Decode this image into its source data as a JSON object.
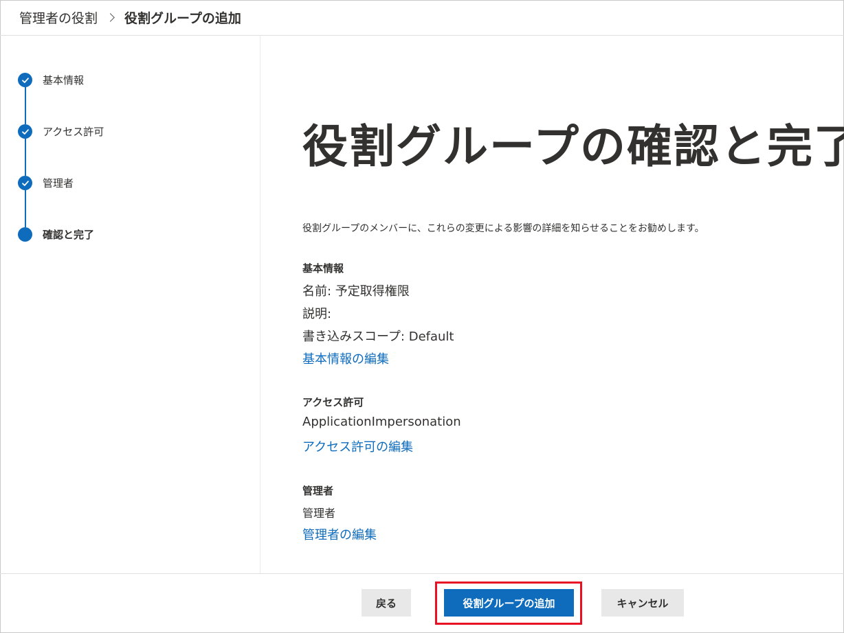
{
  "breadcrumb": {
    "root": "管理者の役割",
    "current": "役割グループの追加"
  },
  "steps": [
    {
      "label": "基本情報",
      "state": "completed"
    },
    {
      "label": "アクセス許可",
      "state": "completed"
    },
    {
      "label": "管理者",
      "state": "completed"
    },
    {
      "label": "確認と完了",
      "state": "current"
    }
  ],
  "main": {
    "title": "役割グループの確認と完了",
    "intro": "役割グループのメンバーに、これらの変更による影響の詳細を知らせることをお勧めします。",
    "basic": {
      "heading": "基本情報",
      "name": "名前: 予定取得権限",
      "description": "説明:",
      "write_scope": "書き込みスコープ: Default",
      "edit_link": "基本情報の編集"
    },
    "permissions": {
      "heading": "アクセス許可",
      "value": "ApplicationImpersonation",
      "edit_link": "アクセス許可の編集"
    },
    "admins": {
      "heading": "管理者",
      "value": "管理者",
      "edit_link": "管理者の編集"
    }
  },
  "footer": {
    "back_label": "戻る",
    "add_label": "役割グループの追加",
    "cancel_label": "キャンセル"
  },
  "colors": {
    "accent": "#0f6cbd",
    "highlight": "#e81123"
  }
}
